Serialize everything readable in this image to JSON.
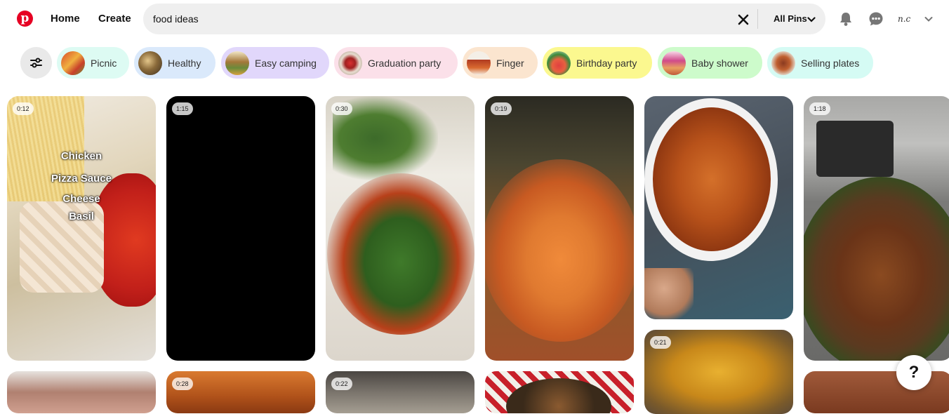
{
  "header": {
    "nav": {
      "home": "Home",
      "create": "Create"
    },
    "search": {
      "value": "food ideas",
      "scope_label": "All Pins"
    },
    "icons": {
      "logo": "pinterest-logo",
      "clear": "close-icon",
      "scope": "chevron-down-icon",
      "notifications": "bell-icon",
      "messages": "chat-bubble-icon",
      "account": "chevron-down-icon"
    },
    "avatar_text": "n.c"
  },
  "filters": {
    "button_icon": "sliders-icon",
    "chips": [
      {
        "label": "Picnic",
        "bg": "#ddfbf3"
      },
      {
        "label": "Healthy",
        "bg": "#dae9fb"
      },
      {
        "label": "Easy camping",
        "bg": "#e1d7fb"
      },
      {
        "label": "Graduation party",
        "bg": "#fbe0e9"
      },
      {
        "label": "Finger",
        "bg": "#fbe5cf"
      },
      {
        "label": "Birthday party",
        "bg": "#fbf88f"
      },
      {
        "label": "Baby shower",
        "bg": "#cdfbcb"
      },
      {
        "label": "Selling plates",
        "bg": "#d5fbf4"
      }
    ]
  },
  "pins": [
    {
      "duration": "0:12",
      "overlay": [
        "Chicken",
        "Pizza Sauce",
        "Cheese",
        "Basil"
      ]
    },
    {
      "duration": "1:15"
    },
    {
      "duration": "0:30"
    },
    {
      "duration": "0:19"
    },
    {
      "duration": ""
    },
    {
      "duration": "1:18"
    },
    {
      "duration": "0:21"
    },
    {
      "duration": ""
    },
    {
      "duration": "0:28"
    },
    {
      "duration": "0:22"
    },
    {
      "duration": ""
    },
    {
      "duration": ""
    }
  ],
  "help": {
    "label": "?"
  }
}
